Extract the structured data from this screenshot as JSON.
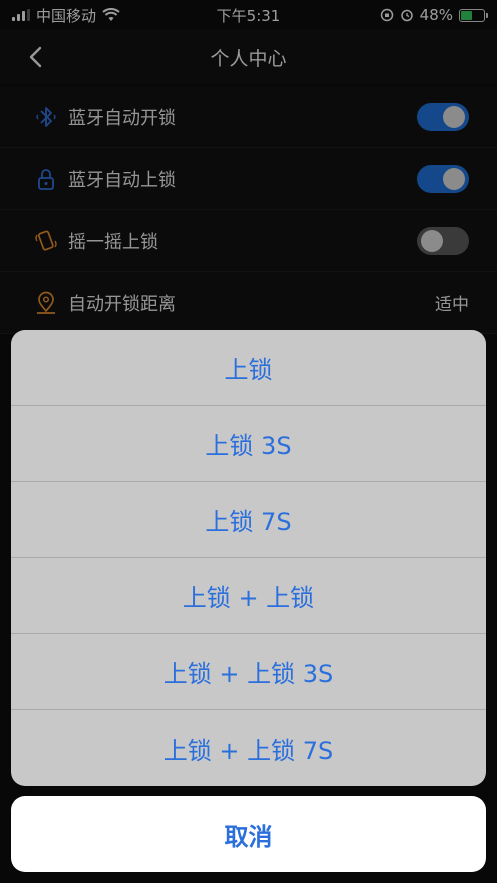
{
  "status_bar": {
    "carrier": "中国移动",
    "time": "下午5:31",
    "battery_percent": "48%",
    "battery_level": 0.48
  },
  "nav": {
    "title": "个人中心"
  },
  "settings": {
    "items": [
      {
        "label": "蓝牙自动开锁",
        "icon": "bluetooth-icon",
        "icon_color": "#2f6fd8",
        "toggle": true
      },
      {
        "label": "蓝牙自动上锁",
        "icon": "lock-icon",
        "icon_color": "#2f6fd8",
        "toggle": true
      },
      {
        "label": "摇一摇上锁",
        "icon": "shake-phone-icon",
        "icon_color": "#e08a2c",
        "toggle": false
      },
      {
        "label": "自动开锁距离",
        "icon": "location-pin-icon",
        "icon_color": "#e08a2c",
        "value": "适中"
      }
    ]
  },
  "action_sheet": {
    "options": [
      "上锁",
      "上锁 3S",
      "上锁 7S",
      "上锁 + 上锁",
      "上锁 + 上锁 3S",
      "上锁 + 上锁 7S"
    ],
    "cancel_label": "取消"
  },
  "colors": {
    "accent": "#2a6fdc",
    "toggle_on": "#1f6fd6",
    "toggle_off": "#5a5a5a",
    "background": "#0d0d0d"
  }
}
